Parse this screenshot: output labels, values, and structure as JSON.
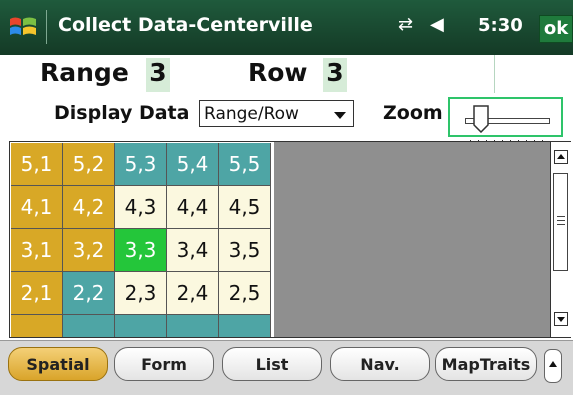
{
  "titlebar": {
    "title": "Collect Data-Centerville",
    "time": "5:30",
    "ok_label": "ok",
    "windows_icon": "windows-flag-icon",
    "connectivity_icon": "connectivity-arrows-icon",
    "volume_icon": "speaker-icon",
    "bar_color": "#1f5a3c"
  },
  "header": {
    "range_label": "Range",
    "range_value": "3",
    "row_label": "Row",
    "row_value": "3"
  },
  "controls": {
    "display_label": "Display Data",
    "display_value": "Range/Row",
    "zoom_label": "Zoom",
    "zoom_level": 0.12
  },
  "grid": {
    "rows": [
      [
        {
          "label": "5,1",
          "state": "gold"
        },
        {
          "label": "5,2",
          "state": "gold"
        },
        {
          "label": "5,3",
          "state": "teal"
        },
        {
          "label": "5,4",
          "state": "teal"
        },
        {
          "label": "5,5",
          "state": "teal"
        }
      ],
      [
        {
          "label": "4,1",
          "state": "gold"
        },
        {
          "label": "4,2",
          "state": "gold"
        },
        {
          "label": "4,3",
          "state": "cream"
        },
        {
          "label": "4,4",
          "state": "cream"
        },
        {
          "label": "4,5",
          "state": "cream"
        }
      ],
      [
        {
          "label": "3,1",
          "state": "gold"
        },
        {
          "label": "3,2",
          "state": "gold"
        },
        {
          "label": "3,3",
          "state": "green"
        },
        {
          "label": "3,4",
          "state": "cream"
        },
        {
          "label": "3,5",
          "state": "cream"
        }
      ],
      [
        {
          "label": "2,1",
          "state": "gold"
        },
        {
          "label": "2,2",
          "state": "teal"
        },
        {
          "label": "2,3",
          "state": "cream"
        },
        {
          "label": "2,4",
          "state": "cream"
        },
        {
          "label": "2,5",
          "state": "cream"
        }
      ],
      [
        {
          "label": "",
          "state": "gold"
        },
        {
          "label": "",
          "state": "teal"
        },
        {
          "label": "",
          "state": "teal"
        },
        {
          "label": "",
          "state": "teal"
        },
        {
          "label": "",
          "state": "teal"
        }
      ]
    ],
    "colors": {
      "gold": "#d8a826",
      "teal": "#4ea5a5",
      "cream": "#fbf8df",
      "green": "#24c63a",
      "empty": "#8f8f8f"
    }
  },
  "tabs": [
    {
      "label": "Spatial",
      "active": true
    },
    {
      "label": "Form",
      "active": false
    },
    {
      "label": "List",
      "active": false
    },
    {
      "label": "Nav.",
      "active": false
    },
    {
      "label": "MapTraits",
      "active": false
    }
  ]
}
